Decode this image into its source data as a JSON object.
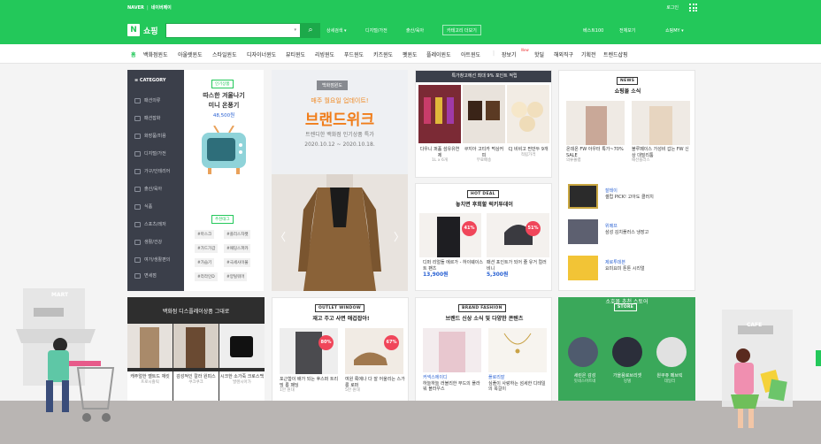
{
  "header": {
    "naver": "NAVER",
    "sep": "|",
    "naverpay": "네이버페이",
    "login": "로그인",
    "logo_n": "N",
    "logo_text": "쇼핑",
    "search_caret": "▾",
    "search_btn": "⌕",
    "links": {
      "detail": "상세검색 ▾",
      "digital": "디지털/가전",
      "kids": "출산/육아",
      "category_more": "카테고리 더보기",
      "best100": "베스트100",
      "all_services": "전체보기",
      "my": "쇼핑MY ▾"
    }
  },
  "nav": {
    "items": [
      "홈",
      "백화점윈도",
      "아울렛윈도",
      "스타일윈도",
      "디자이너윈도",
      "뷰티윈도",
      "리빙윈도",
      "푸드윈도",
      "키즈윈도",
      "펫윈도",
      "플레이윈도",
      "아트윈도"
    ],
    "sep": "|",
    "extra": [
      "장보기",
      "핫딜",
      "해외직구",
      "기획전",
      "트렌드샵핑"
    ],
    "new_badge": "New"
  },
  "category": {
    "title": "≡  CATEGORY",
    "items": [
      "패션의류",
      "패션잡화",
      "화장품/미용",
      "디지털/가전",
      "가구/인테리어",
      "출산/육아",
      "식품",
      "스포츠/레저",
      "생활/건강",
      "여가/생활편의",
      "면세점"
    ]
  },
  "promo1": {
    "tag": "인기상품",
    "title1": "따스한 겨울나기",
    "title2": "미니 온풍기",
    "price": "48,500원",
    "tag2": "추천태그",
    "hashtags": [
      "#마스크",
      "#플리스자켓",
      "#가드가갑",
      "#패딩스파카",
      "#가습기",
      "#극세사이불",
      "#라라인D",
      "#양털워머"
    ]
  },
  "big": {
    "tag": "백화점윈도",
    "line1": "매주 월요일 업데이트!",
    "line2": "브랜드위크",
    "line3": "트렌디한 백화점 인기상품 특가",
    "dates": "2020.10.12 ~ 2020.10.18.",
    "left_arrow": "〈",
    "right_arrow": "〉"
  },
  "deal": {
    "banner": "특가창고에선 최대 9% 포인트 적립",
    "items": [
      {
        "t": "다우니 퍼퓸 섬유유연제",
        "s": "1L x 6개"
      },
      {
        "t": "쿠지아 고티카 먹상커피",
        "s": "무료배송"
      },
      {
        "t": "CJ 비비고 찐만두 9개",
        "s": "적립가격"
      }
    ]
  },
  "hot": {
    "badge": "HOT DEAL",
    "title": "놓치면 후회할 럭키투데이",
    "items": [
      {
        "t": "디퍼 리얼돌 에르가 - 하이웨이스트 팬츠",
        "disc": "41%",
        "p": "13,900원"
      },
      {
        "t": "패션 포인트가 되어 줄 유거 컬러 비니",
        "disc": "51%",
        "p": "5,300원"
      }
    ]
  },
  "news": {
    "badge": "NEWS",
    "title": "쇼핑몰 소식",
    "items": [
      {
        "t": "온데온 FW 아우터 특가~70% SALE",
        "s": "의류몰랩"
      },
      {
        "t": "블루페이스 가성비 갑는 FW 신상 대밀리툼",
        "s": "패션플러스"
      }
    ],
    "list": [
      {
        "t": "잘테이",
        "s": "셀럽 PICK! 고아도 클러치"
      },
      {
        "t": "위메프",
        "s": "삼성 김치플러스 냉장고"
      },
      {
        "t": "제로투데븐",
        "s": "요미요미 톤톤 시리얼"
      }
    ]
  },
  "dept": {
    "title": "백화점 디스플레이상품 그대로",
    "items": [
      {
        "t": "캐주얼한 벨트드 재킷",
        "s": "프로시즐릭"
      },
      {
        "t": "감성적인 칼라 원피스",
        "s": "쿠크쿠크"
      },
      {
        "t": "시크한 소가죽 크로스백",
        "s": "발렌시아가"
      }
    ]
  },
  "outlet": {
    "badge": "OUTLET WINDOW",
    "title": "재고 주고 사면 애겁잡아!",
    "items": [
      {
        "t": "포근함이 배가 되는 후스퍼 트리밍 롱 패딩",
        "s": "1만 원대",
        "disc": "80%"
      },
      {
        "t": "여원 룩에나 다 잘 어울리는 스가롱 로퍼",
        "s": "5만 원대",
        "disc": "67%"
      }
    ]
  },
  "brand": {
    "badge": "BRAND FASHION",
    "title": "브랜드 신상 소식 및 다양한 콘텐츠",
    "items": [
      {
        "t": "커넥스에이디",
        "s": "하늘하늘 러블리한 무드의 플라워 블라우스"
      },
      {
        "t": "플로리잘",
        "s": "심플이 사랑하는 섬세한 디테일의 목걸이"
      }
    ]
  },
  "store": {
    "badge": "STORE",
    "title": "소호몰 추천 스토어",
    "items": [
      {
        "t": "세린은 감성",
        "s": "잇네스어트네"
      },
      {
        "t": "가을용로브리셋",
        "s": "밍델"
      },
      {
        "t": "원쿠쥬 페브릭",
        "s": "데일리"
      }
    ]
  },
  "decor": {
    "mart": "MART",
    "cafe": "CAFE"
  },
  "colors": {
    "brand": "#23c85a",
    "price": "#2a62d3",
    "discount": "#f0465a"
  }
}
